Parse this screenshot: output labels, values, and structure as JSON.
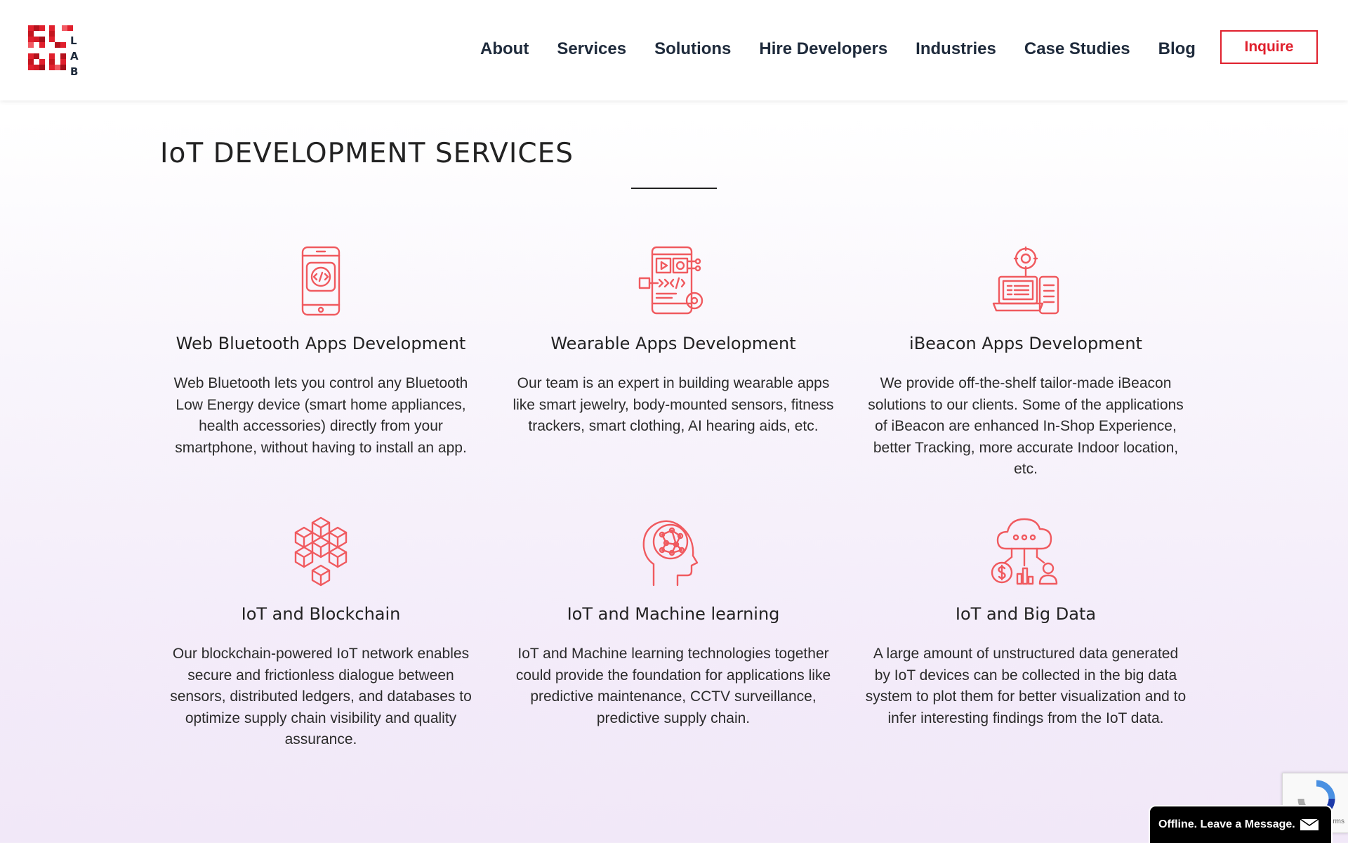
{
  "header": {
    "logo_alt": "SL DU LAB",
    "nav": [
      {
        "label": "About",
        "icon": null
      },
      {
        "label": "Services"
      },
      {
        "label": "Solutions"
      },
      {
        "label": "Hire Developers"
      },
      {
        "label": "Industries"
      },
      {
        "label": "Case Studies"
      },
      {
        "label": "Blog"
      }
    ],
    "inquire_label": "Inquire"
  },
  "section": {
    "title": "IoT DEVELOPMENT SERVICES"
  },
  "cards": [
    {
      "icon": "smartphone-code-icon",
      "title": "Web Bluetooth Apps Development",
      "text": "Web Bluetooth lets you control any Bluetooth Low Energy device (smart home appliances, health accessories) directly from your smartphone, without having to install an app."
    },
    {
      "icon": "wearable-app-icon",
      "title": "Wearable Apps Development",
      "text": "Our team is an expert in building wearable apps like smart jewelry, body-mounted sensors, fitness trackers, smart clothing, AI hearing aids, etc."
    },
    {
      "icon": "ibeacon-devices-icon",
      "title": "iBeacon Apps Development",
      "text": "We provide off-the-shelf tailor-made iBeacon solutions to our clients. Some of the applications of iBeacon are enhanced In-Shop Experience, better Tracking, more accurate Indoor location, etc."
    },
    {
      "icon": "blockchain-cubes-icon",
      "title": "IoT and Blockchain",
      "text": "Our blockchain-powered IoT network enables secure and frictionless dialogue between sensors, distributed ledgers, and databases to optimize supply chain visibility and quality assurance."
    },
    {
      "icon": "machine-learning-head-icon",
      "title": "IoT and Machine learning",
      "text": "IoT and Machine learning technologies together could provide the foundation for applications like predictive maintenance, CCTV surveillance, predictive supply chain."
    },
    {
      "icon": "big-data-cloud-icon",
      "title": "IoT and Big Data",
      "text": "A large amount of unstructured data generated by IoT devices can be collected in the big data system to plot them for better visualization and to infer interesting findings from the IoT data."
    }
  ],
  "widgets": {
    "recaptcha_terms": "rms",
    "chat_label": "Offline. Leave a Message."
  },
  "colors": {
    "accent": "#e0202d",
    "icon": "#f05a5f",
    "nav_text": "#1e2a3b"
  }
}
